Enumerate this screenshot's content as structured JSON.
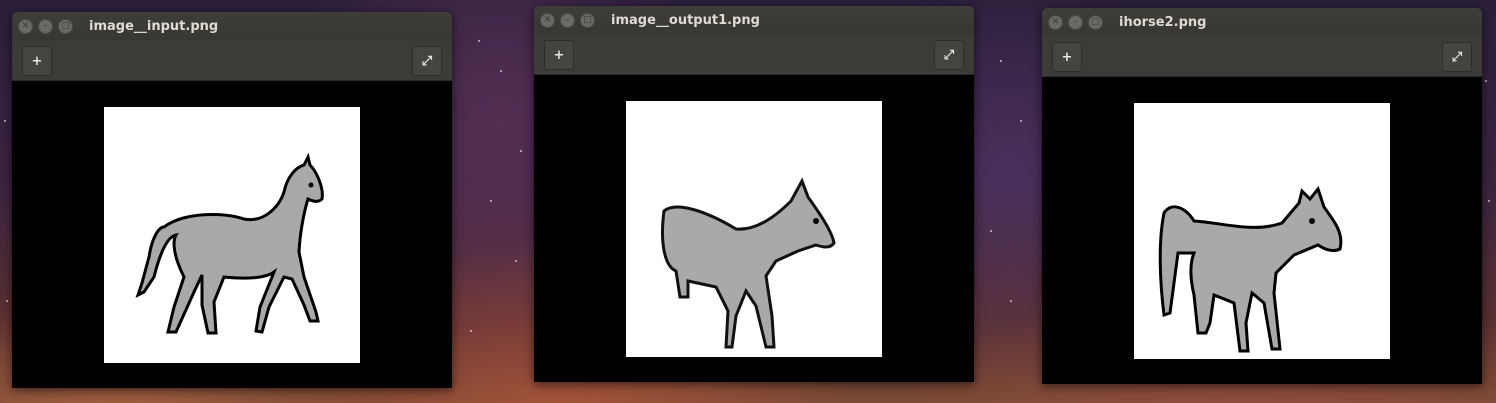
{
  "desktop": {
    "accent_color": "#3c3b37"
  },
  "windows": [
    {
      "title": "image__input.png",
      "close_icon": "close-icon",
      "minimize_icon": "minimize-icon",
      "maximize_icon": "maximize-icon",
      "toolbar": {
        "add_icon": "plus-icon",
        "fullscreen_icon": "fullscreen-icon"
      },
      "image": {
        "subject": "horse"
      }
    },
    {
      "title": "image__output1.png",
      "close_icon": "close-icon",
      "minimize_icon": "minimize-icon",
      "maximize_icon": "maximize-icon",
      "toolbar": {
        "add_icon": "plus-icon",
        "fullscreen_icon": "fullscreen-icon"
      },
      "image": {
        "subject": "horse"
      }
    },
    {
      "title": "ihorse2.png",
      "close_icon": "close-icon",
      "minimize_icon": "minimize-icon",
      "maximize_icon": "maximize-icon",
      "toolbar": {
        "add_icon": "plus-icon",
        "fullscreen_icon": "fullscreen-icon"
      },
      "image": {
        "subject": "horse"
      }
    }
  ]
}
